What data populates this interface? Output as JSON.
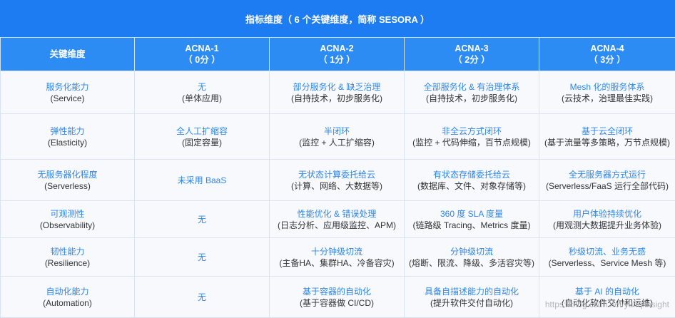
{
  "header": {
    "title": "指标维度（ 6 个关键维度，简称 SESORA ）"
  },
  "columns": [
    {
      "line1": "关键维度",
      "line2": ""
    },
    {
      "line1": "ACNA-1",
      "line2": "（ 0分 ）"
    },
    {
      "line1": "ACNA-2",
      "line2": "（ 1分 ）"
    },
    {
      "line1": "ACNA-3",
      "line2": "（ 2分 ）"
    },
    {
      "line1": "ACNA-4",
      "line2": "（ 3分 ）"
    }
  ],
  "rows": [
    {
      "dimension": {
        "name": "服务化能力",
        "en": "(Service)"
      },
      "cells": [
        {
          "main": "无",
          "sub": "(单体应用)"
        },
        {
          "main": "部分服务化 & 缺乏治理",
          "sub": "(自持技术，初步服务化)"
        },
        {
          "main": "全部服务化 & 有治理体系",
          "sub": "(自持技术，初步服务化)"
        },
        {
          "main": "Mesh 化的服务体系",
          "sub": "(云技术，治理最佳实践)"
        }
      ]
    },
    {
      "dimension": {
        "name": "弹性能力",
        "en": "(Elasticity)"
      },
      "cells": [
        {
          "main": "全人工扩缩容",
          "sub": "(固定容量)"
        },
        {
          "main": "半闭环",
          "sub": "(监控 + 人工扩缩容)"
        },
        {
          "main": "非全云方式闭环",
          "sub": "(监控 + 代码伸缩，百节点规模)"
        },
        {
          "main": "基于云全闭环",
          "sub": "(基于流量等多策略，万节点规模)"
        }
      ]
    },
    {
      "dimension": {
        "name": "无服务器化程度",
        "en": "(Serverless)"
      },
      "cells": [
        {
          "main": "未采用 BaaS",
          "sub": ""
        },
        {
          "main": "无状态计算委托给云",
          "sub": "(计算、网络、大数据等)"
        },
        {
          "main": "有状态存储委托给云",
          "sub": "(数据库、文件、对象存储等)"
        },
        {
          "main": "全无服务器方式运行",
          "sub": "(Serverless/FaaS 运行全部代码)"
        }
      ]
    },
    {
      "dimension": {
        "name": "可观测性",
        "en": "(Observability)"
      },
      "cells": [
        {
          "main": "无",
          "sub": ""
        },
        {
          "main": "性能优化 & 错误处理",
          "sub": "(日志分析、应用级监控、APM)"
        },
        {
          "main": "360 度 SLA 度量",
          "sub": "(链路级 Tracing、Metrics 度量)"
        },
        {
          "main": "用户体验持续优化",
          "sub": "(用观测大数据提升业务体验)"
        }
      ]
    },
    {
      "dimension": {
        "name": "韧性能力",
        "en": "(Resilience)"
      },
      "cells": [
        {
          "main": "无",
          "sub": ""
        },
        {
          "main": "十分钟级切流",
          "sub": "(主备HA、集群HA、冷备容灾)"
        },
        {
          "main": "分钟级切流",
          "sub": "(熔断、限流、降级、多活容灾等)"
        },
        {
          "main": "秒级切流、业务无感",
          "sub": "(Serverless、Service Mesh 等)"
        }
      ]
    },
    {
      "dimension": {
        "name": "自动化能力",
        "en": "(Automation)"
      },
      "cells": [
        {
          "main": "无",
          "sub": ""
        },
        {
          "main": "基于容器的自动化",
          "sub": "(基于容器做 CI/CD)"
        },
        {
          "main": "具备自描述能力的自动化",
          "sub": "(提升软件交付自动化)"
        },
        {
          "main": "基于 AI 的自动化",
          "sub": "(自动化软件交付和运维)"
        }
      ]
    }
  ],
  "watermark": "https://blog.csdn.net/yunqiinsight"
}
